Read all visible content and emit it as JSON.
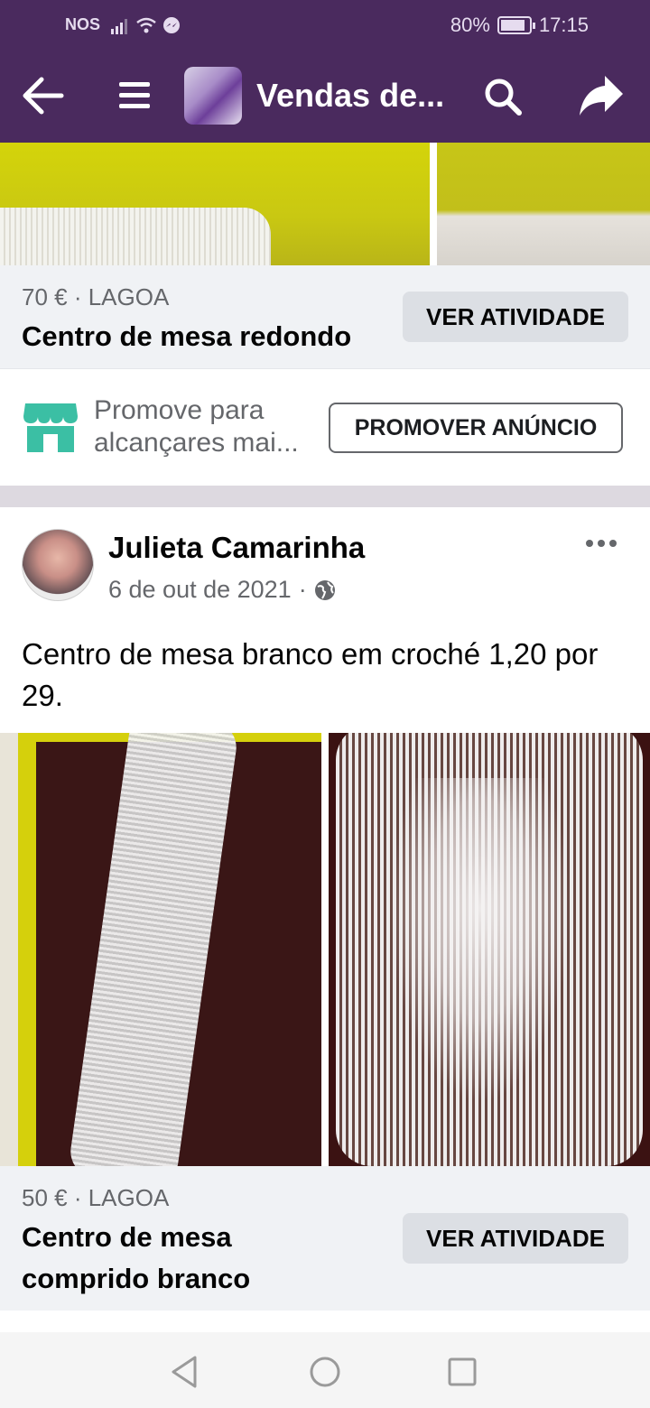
{
  "status_bar": {
    "carrier": "NOS",
    "battery": "80%",
    "time": "17:15"
  },
  "app_bar": {
    "title": "Vendas de..."
  },
  "listing_1": {
    "price_location": "70 € · LAGOA",
    "name": "Centro de mesa redondo",
    "button": "VER ATIVIDADE"
  },
  "promo": {
    "text": "Promove para alcançares mai...",
    "button": "PROMOVER ANÚNCIO"
  },
  "post": {
    "author": "Julieta Camarinha",
    "date": "6 de out de 2021",
    "separator": "·",
    "text": "Centro de mesa branco em croché 1,20 por 29."
  },
  "listing_2": {
    "price_location": "50 € · LAGOA",
    "name": "Centro de mesa comprido branco",
    "button": "VER ATIVIDADE"
  },
  "colors": {
    "header_purple": "#4a2a5e",
    "promo_green": "#3bbfa4",
    "gray_button": "#dcdfe4"
  },
  "icons": [
    "back-arrow-icon",
    "hamburger-menu-icon",
    "search-icon",
    "share-icon",
    "storefront-icon",
    "globe-icon",
    "more-options-icon",
    "nav-back-icon",
    "nav-home-icon",
    "nav-recents-icon"
  ]
}
